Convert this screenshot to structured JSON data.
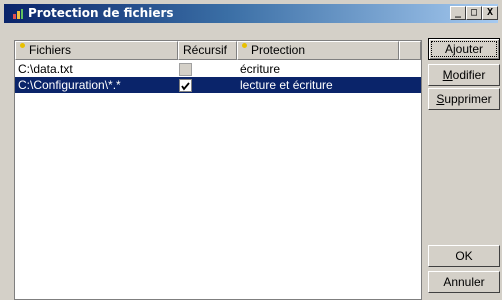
{
  "window": {
    "title": "Protection de fichiers"
  },
  "caption_buttons": {
    "minimize": "_",
    "maximize": "□",
    "close": "X"
  },
  "table": {
    "columns": [
      {
        "label": "Fichiers",
        "sort_indicator": true
      },
      {
        "label": "Récursif",
        "sort_indicator": false
      },
      {
        "label": "Protection",
        "sort_indicator": true
      },
      {
        "label": "",
        "sort_indicator": false
      }
    ],
    "rows": [
      {
        "file": "C:\\data.txt",
        "recursive": false,
        "protection": "écriture",
        "selected": false
      },
      {
        "file": "C:\\Configuration\\*.*",
        "recursive": true,
        "protection": "lecture et écriture",
        "selected": true
      }
    ]
  },
  "buttons": {
    "add": {
      "first": "A",
      "mnemonic": "j",
      "rest": "outer"
    },
    "modify": {
      "first": "",
      "mnemonic": "M",
      "rest": "odifier"
    },
    "delete": {
      "first": "",
      "mnemonic": "S",
      "rest": "upprimer"
    },
    "ok": "OK",
    "cancel": "Annuler"
  },
  "colors": {
    "selection": "#0a246a",
    "face": "#d4d0c8",
    "sort_dot": "#e8c000"
  }
}
